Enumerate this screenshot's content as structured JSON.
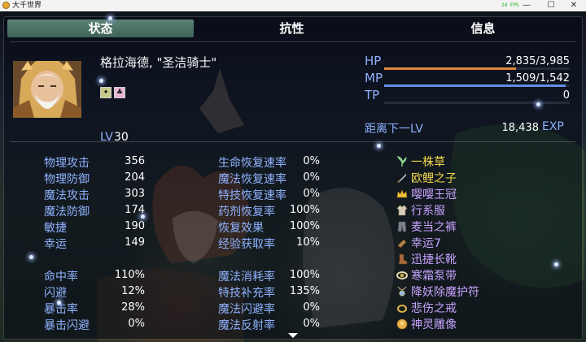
{
  "window": {
    "title": "大千世界",
    "fps": "24 FPS",
    "minimize": "—",
    "maximize": "☐",
    "close": "✕"
  },
  "tabs": [
    {
      "label": "状态",
      "active": true
    },
    {
      "label": "抗性",
      "active": false
    },
    {
      "label": "信息",
      "active": false
    }
  ],
  "character": {
    "name": "格拉海德, \"圣洁骑士\"",
    "level_label": "LV",
    "level_value": "30",
    "state_icons": [
      "shield-state-icon",
      "pink-buff-icon"
    ]
  },
  "gauges": [
    {
      "label": "HP",
      "value": "2,835/3,985",
      "fill": 0.711,
      "color": "#e0873a"
    },
    {
      "label": "MP",
      "value": "1,509/1,542",
      "fill": 0.979,
      "color": "#5f8fe8"
    },
    {
      "label": "TP",
      "value": "0",
      "fill": 0,
      "color": "#3cbf6a"
    }
  ],
  "exp": {
    "label": "距离下一LV",
    "value": "18,438",
    "unit": "EXP"
  },
  "params_left": [
    {
      "label": "物理攻击",
      "value": "356"
    },
    {
      "label": "物理防御",
      "value": "204"
    },
    {
      "label": "魔法攻击",
      "value": "303"
    },
    {
      "label": "魔法防御",
      "value": "174"
    },
    {
      "label": "敏捷",
      "value": "190"
    },
    {
      "label": "幸运",
      "value": "149"
    }
  ],
  "params_mid": [
    {
      "label": "生命恢复速率",
      "value": "0%"
    },
    {
      "label": "魔法恢复速率",
      "value": "0%"
    },
    {
      "label": "特技恢复速率",
      "value": "0%"
    },
    {
      "label": "药剂恢复率",
      "value": "100%"
    },
    {
      "label": "恢复效果",
      "value": "100%"
    },
    {
      "label": "经验获取率",
      "value": "10%"
    }
  ],
  "params_left2": [
    {
      "label": "命中率",
      "value": "110%"
    },
    {
      "label": "闪避",
      "value": "12%"
    },
    {
      "label": "暴击率",
      "value": "28%"
    },
    {
      "label": "暴击闪避",
      "value": "0%"
    }
  ],
  "params_mid2": [
    {
      "label": "魔法消耗率",
      "value": "100%"
    },
    {
      "label": "特技补充率",
      "value": "135%"
    },
    {
      "label": "魔法闪避率",
      "value": "0%"
    },
    {
      "label": "魔法反射率",
      "value": "0%"
    }
  ],
  "equipment": [
    {
      "name": "一株草",
      "color": "#f2d64b",
      "icon": "herb-icon"
    },
    {
      "name": "欧鲤之子",
      "color": "#f2d64b",
      "icon": "dagger-icon"
    },
    {
      "name": "嘤嘤王冠",
      "color": "#c7a3ff",
      "icon": "crown-icon"
    },
    {
      "name": "行系服",
      "color": "#c7a3ff",
      "icon": "armor-icon"
    },
    {
      "name": "麦当之裤",
      "color": "#c7a3ff",
      "icon": "pants-icon"
    },
    {
      "name": "幸运7",
      "color": "#c7a3ff",
      "icon": "bracer-icon"
    },
    {
      "name": "迅捷长靴",
      "color": "#c7a3ff",
      "icon": "boots-icon"
    },
    {
      "name": "寒霜泵带",
      "color": "#c7a3ff",
      "icon": "belt-icon"
    },
    {
      "name": "降妖除魔护符",
      "color": "#c7a3ff",
      "icon": "amulet-icon"
    },
    {
      "name": "悲伤之戒",
      "color": "#c7a3ff",
      "icon": "ring-icon"
    },
    {
      "name": "神灵雕像",
      "color": "#c7a3ff",
      "icon": "statue-icon"
    }
  ]
}
